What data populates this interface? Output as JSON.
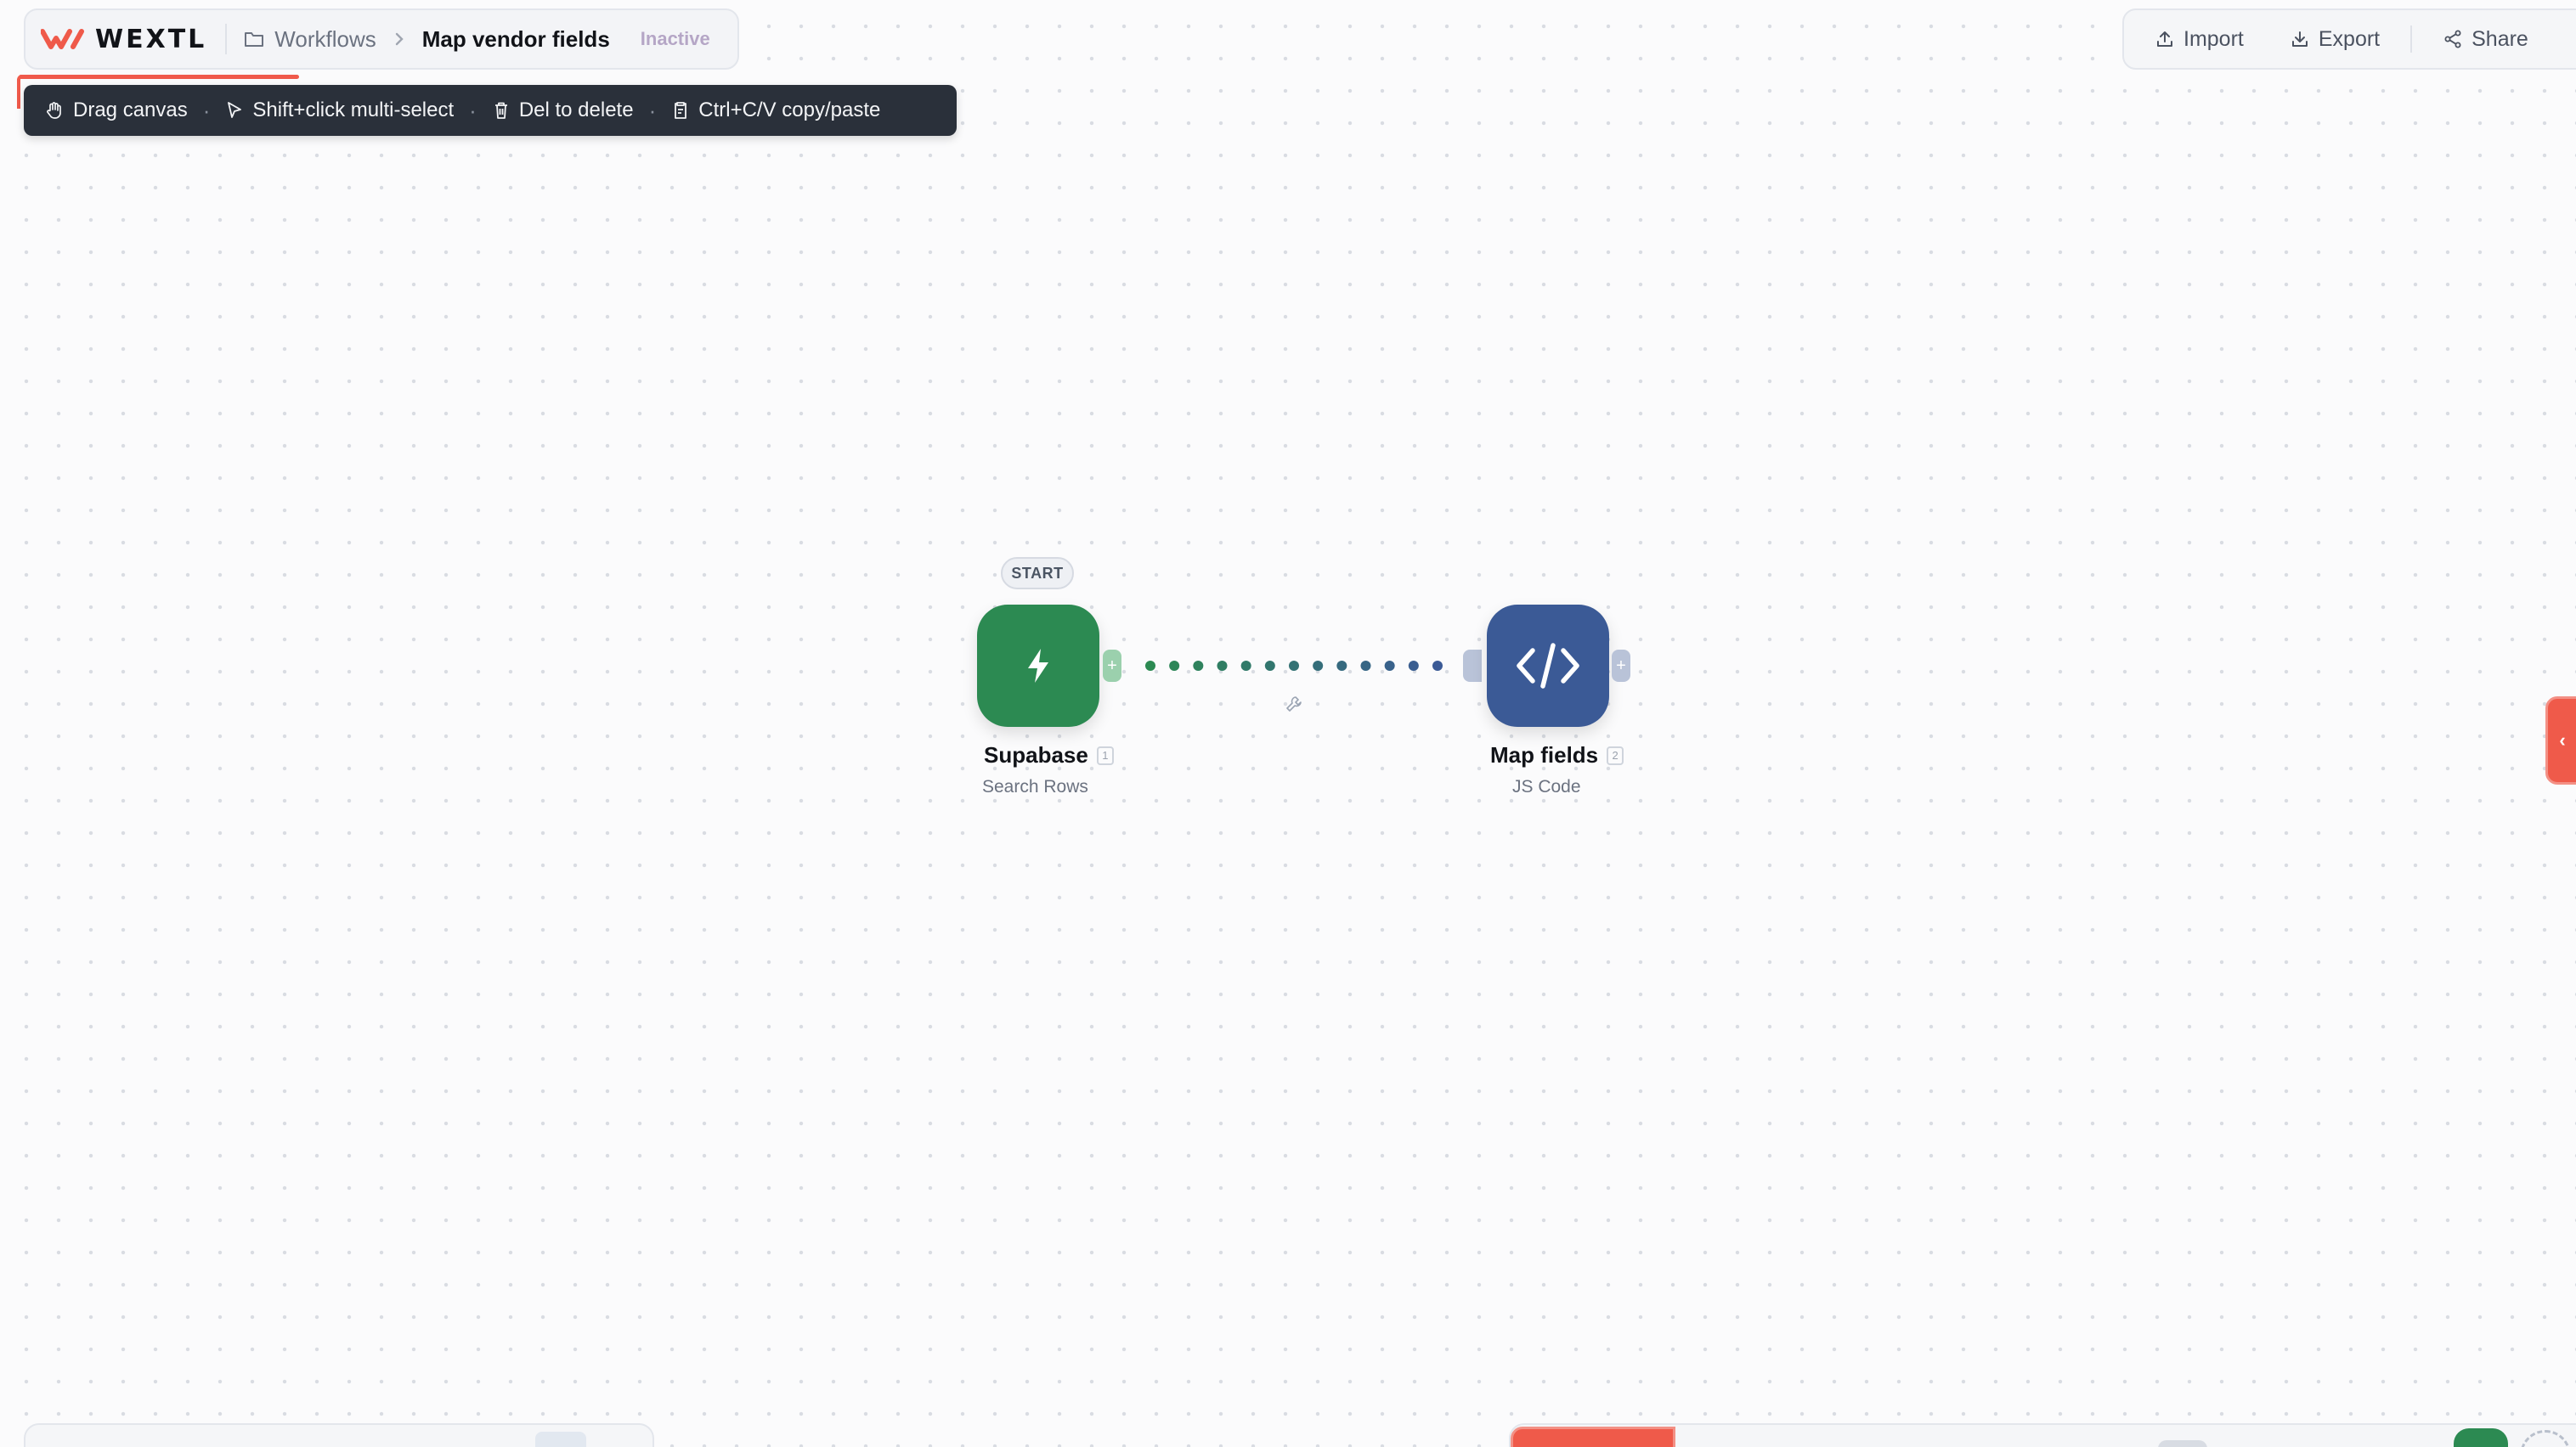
{
  "app": {
    "brand": "WEXTL"
  },
  "breadcrumb": {
    "parent": "Workflows",
    "current": "Map vendor fields",
    "status": "Inactive"
  },
  "tips": [
    {
      "icon": "hand-icon",
      "label": "Drag canvas"
    },
    {
      "icon": "cursor-icon",
      "label": "Shift+click multi-select"
    },
    {
      "icon": "trash-icon",
      "label": "Del to delete"
    },
    {
      "icon": "clipboard-icon",
      "label": "Ctrl+C/V copy/paste"
    }
  ],
  "header_actions": {
    "import": "Import",
    "export": "Export",
    "share": "Share"
  },
  "nodes": [
    {
      "title": "Supabase",
      "subtitle": "Search Rows",
      "index": "1",
      "badge": "START",
      "icon": "lightning-icon",
      "color": "#2c8a52"
    },
    {
      "title": "Map fields",
      "subtitle": "JS Code",
      "index": "2",
      "icon": "code-icon",
      "color": "#3b5a96"
    }
  ],
  "ports": {
    "add_symbol": "+"
  },
  "edge_tab": {
    "symbol": "‹"
  },
  "colors": {
    "accent": "#ef5a4a",
    "tips_bg": "#2a303a",
    "connection": "#3a7a6a"
  }
}
